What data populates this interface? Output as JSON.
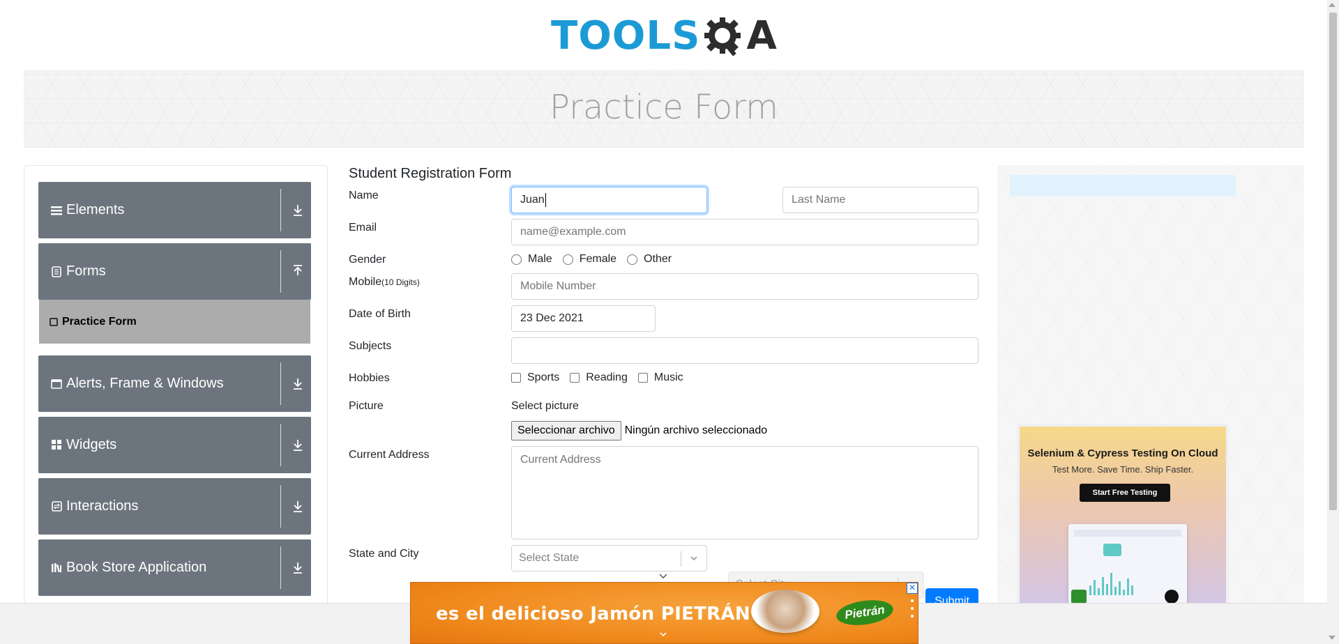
{
  "header": {
    "logo_left": "TOOLS",
    "logo_right": "A",
    "banner_title": "Practice Form"
  },
  "sidebar": {
    "groups": [
      {
        "label": "Elements",
        "icon": "hamburger-icon",
        "arrow": "download-arrow-icon"
      },
      {
        "label": "Forms",
        "icon": "form-icon",
        "arrow": "upload-arrow-icon"
      },
      {
        "label": "Alerts, Frame & Windows",
        "icon": "window-icon",
        "arrow": "download-arrow-icon"
      },
      {
        "label": "Widgets",
        "icon": "grid-icon",
        "arrow": "download-arrow-icon"
      },
      {
        "label": "Interactions",
        "icon": "interaction-icon",
        "arrow": "download-arrow-icon"
      },
      {
        "label": "Book Store Application",
        "icon": "books-icon",
        "arrow": "download-arrow-icon"
      }
    ],
    "active_item": "Practice Form"
  },
  "form": {
    "title": "Student Registration Form",
    "name_label": "Name",
    "first_name_value": "Juan",
    "last_name_placeholder": "Last Name",
    "email_label": "Email",
    "email_placeholder": "name@example.com",
    "gender_label": "Gender",
    "gender_options": [
      "Male",
      "Female",
      "Other"
    ],
    "mobile_label": "Mobile",
    "mobile_hint": "(10 Digits)",
    "mobile_placeholder": "Mobile Number",
    "dob_label": "Date of Birth",
    "dob_value": "23 Dec 2021",
    "subjects_label": "Subjects",
    "hobbies_label": "Hobbies",
    "hobbies_options": [
      "Sports",
      "Reading",
      "Music"
    ],
    "picture_label": "Picture",
    "picture_select_text": "Select picture",
    "file_button": "Seleccionar archivo",
    "file_status": "Ningún archivo seleccionado",
    "address_label": "Current Address",
    "address_placeholder": "Current Address",
    "state_city_label": "State and City",
    "state_placeholder": "Select State",
    "city_placeholder": "Select City",
    "submit_label": "Submit"
  },
  "right_ad": {
    "title": "Selenium & Cypress Testing On Cloud",
    "subtitle": "Test More. Save Time. Ship Faster.",
    "button": "Start Free Testing"
  },
  "bottom_ad": {
    "headline": "es el delicioso Jamón PIETRÁN",
    "brand": "Pietrán",
    "close": "✕"
  },
  "colors": {
    "accent": "#1c9ad6",
    "sidebar_group": "#6c757d",
    "active_item": "#acacac",
    "submit": "#007bff",
    "ad_orange": "#f08a1e"
  }
}
